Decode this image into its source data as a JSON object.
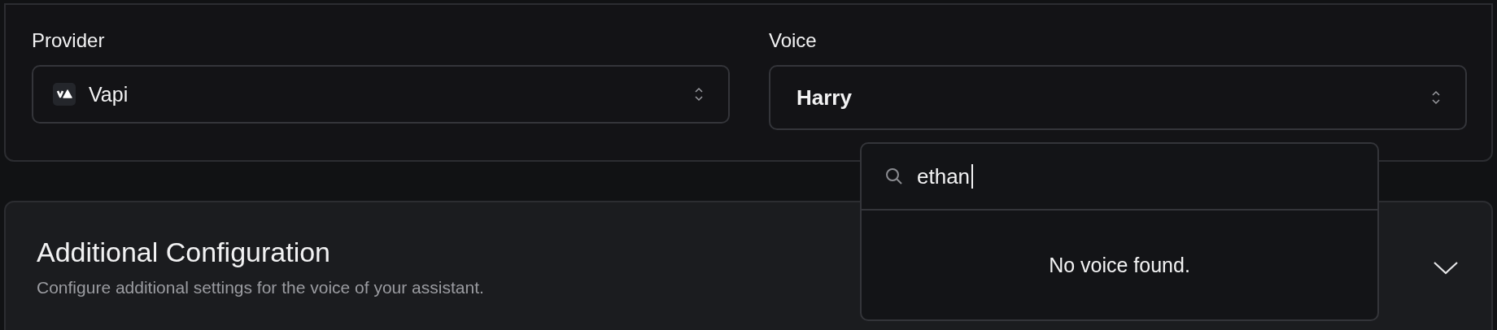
{
  "provider": {
    "label": "Provider",
    "value": "Vapi"
  },
  "voice": {
    "label": "Voice",
    "value": "Harry"
  },
  "voice_dropdown": {
    "search_value": "ethan",
    "empty_message": "No voice found."
  },
  "additional_configuration": {
    "title": "Additional Configuration",
    "description": "Configure additional settings for the voice of your assistant.",
    "expanded": false
  }
}
